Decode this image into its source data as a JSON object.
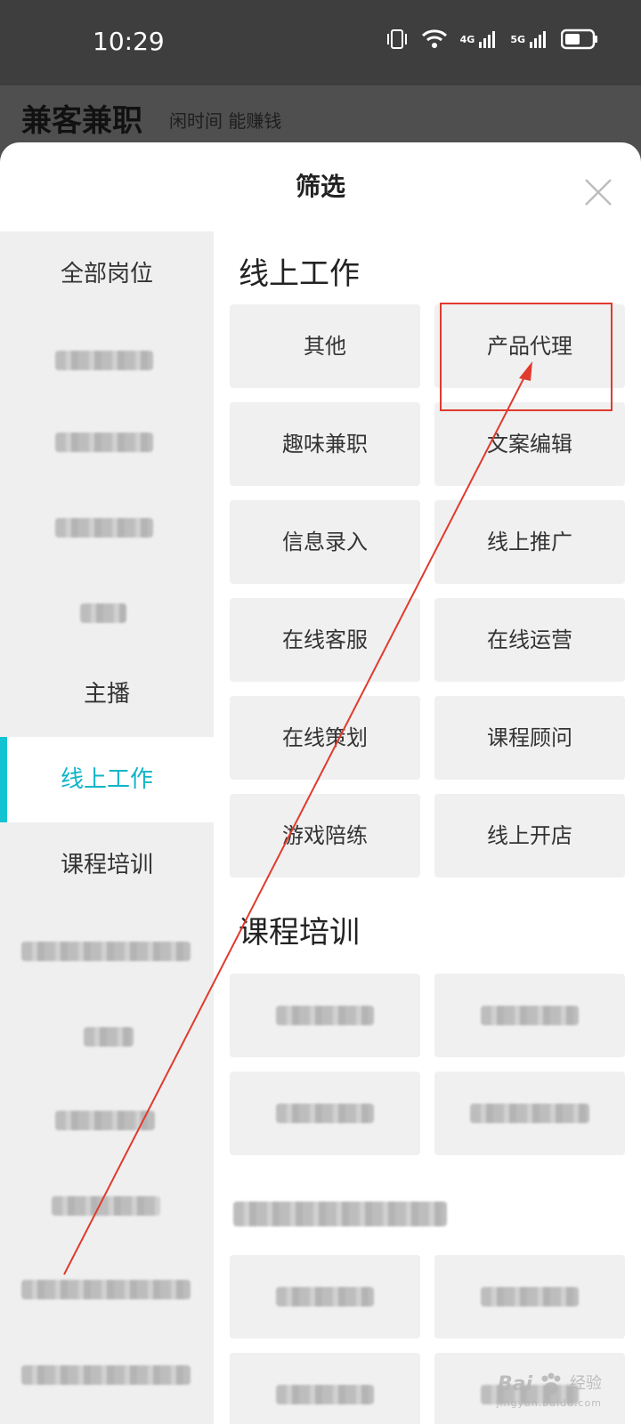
{
  "status_bar": {
    "time": "10:29",
    "network_4g": "4G",
    "network_5g": "5G",
    "icons": [
      "vibrate-icon",
      "wifi-icon",
      "signal-4g-icon",
      "signal-5g-icon",
      "battery-icon"
    ]
  },
  "app_header": {
    "title": "兼客兼职",
    "slogan": "闲时间  能赚钱"
  },
  "sheet": {
    "title": "筛选",
    "close_icon": "close-icon"
  },
  "categories": [
    {
      "label": "全部岗位",
      "blurred": false
    },
    {
      "label": "",
      "blurred": true
    },
    {
      "label": "",
      "blurred": true
    },
    {
      "label": "",
      "blurred": true
    },
    {
      "label": "",
      "blurred": true
    },
    {
      "label": "主播",
      "blurred": false
    },
    {
      "label": "线上工作",
      "blurred": false,
      "active": true
    },
    {
      "label": "课程培训",
      "blurred": false
    },
    {
      "label": "",
      "blurred": true
    },
    {
      "label": "",
      "blurred": true
    },
    {
      "label": "",
      "blurred": true
    },
    {
      "label": "",
      "blurred": true
    },
    {
      "label": "",
      "blurred": true
    },
    {
      "label": "",
      "blurred": true
    }
  ],
  "sections": [
    {
      "title": "线上工作",
      "items": [
        "其他",
        "产品代理",
        "趣味兼职",
        "文案编辑",
        "信息录入",
        "线上推广",
        "在线客服",
        "在线运营",
        "在线策划",
        "课程顾问",
        "游戏陪练",
        "线上开店"
      ]
    },
    {
      "title": "课程培训",
      "items": [
        "",
        "",
        "",
        ""
      ]
    }
  ],
  "annotation": {
    "highlight_color": "#e03a2e",
    "arrow_color": "#e03a2e"
  },
  "watermark": {
    "logo": "Bai",
    "suffix": "经验",
    "url": "jingyan.baidu.com"
  },
  "colors": {
    "accent": "#14c3d2",
    "sidebar_bg": "#efefef",
    "chip_bg": "#f0f0f0"
  }
}
